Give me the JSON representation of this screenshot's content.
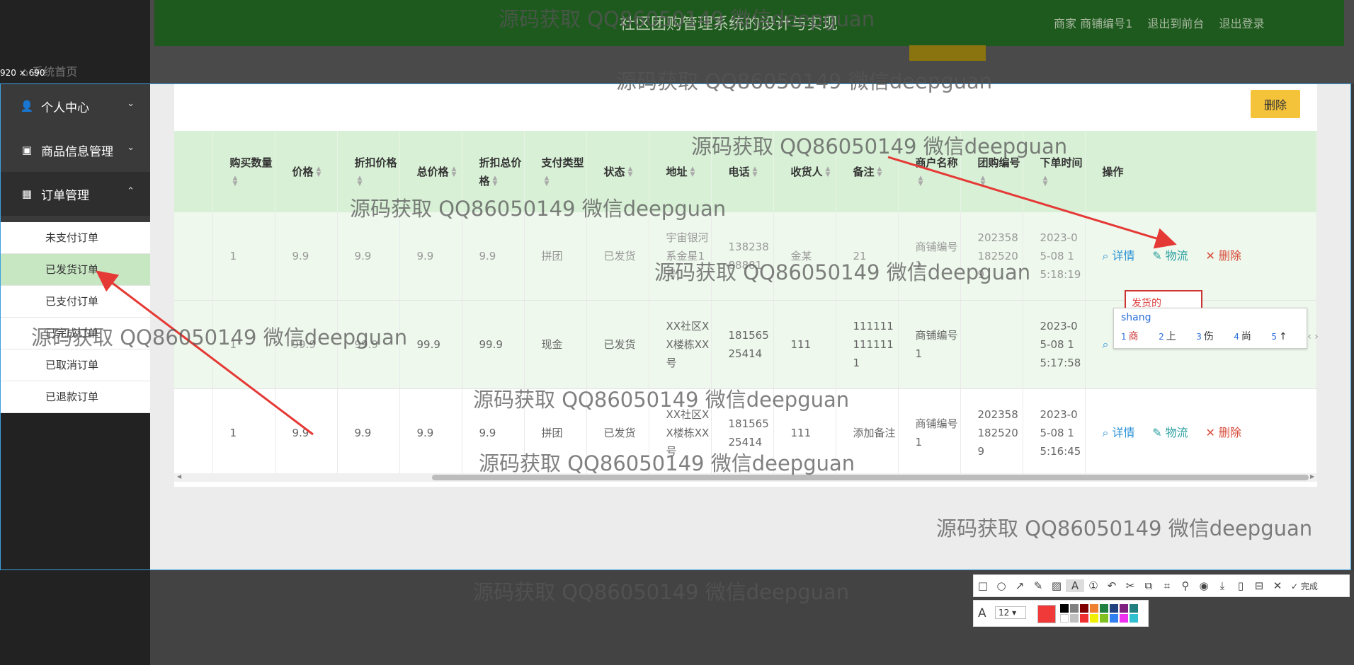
{
  "header": {
    "title": "社区团购管理系统的设计与实现",
    "links": [
      "商家 商铺编号1",
      "退出到前台",
      "退出登录"
    ]
  },
  "home_link": "系统首页",
  "size_label": "920 × 690",
  "sidebar": {
    "menus": [
      {
        "label": "个人中心",
        "icon": "user-icon",
        "chevron": "⌄"
      },
      {
        "label": "商品信息管理",
        "icon": "chat-icon",
        "chevron": "⌄"
      },
      {
        "label": "订单管理",
        "icon": "grid-icon",
        "chevron": "⌃"
      }
    ],
    "submenu": [
      "未支付订单",
      "已发货订单",
      "已支付订单",
      "已完成订单",
      "已取消订单",
      "已退款订单"
    ],
    "active_submenu": "已发货订单"
  },
  "toolbar": {
    "delete_label": "删除"
  },
  "table": {
    "headers": [
      "购买数量",
      "价格",
      "折扣价格",
      "总价格",
      "折扣总价格",
      "支付类型",
      "状态",
      "地址",
      "电话",
      "收货人",
      "备注",
      "商户名称",
      "团购编号",
      "下单时间",
      "操作"
    ],
    "rows": [
      {
        "qty": "1",
        "price": "9.9",
        "discount_price": "9.9",
        "total": "9.9",
        "discount_total": "9.9",
        "pay": "拼团",
        "status": "已发货",
        "address": "宇宙银河系金星1号",
        "phone": "13823888881",
        "receiver": "金某",
        "note": "21",
        "merchant": "商铺编号1",
        "groupno": "2023581825209",
        "time": "2023-05-08 15:18:19"
      },
      {
        "qty": "1",
        "price": "99.9",
        "discount_price": "99.9",
        "total": "99.9",
        "discount_total": "99.9",
        "pay": "现金",
        "status": "已发货",
        "address": "XX社区XX楼栋XX号",
        "phone": "18156525414",
        "receiver": "111",
        "note": "1111111111111",
        "merchant": "商铺编号1",
        "groupno": "",
        "time": "2023-05-08 15:17:58"
      },
      {
        "qty": "1",
        "price": "9.9",
        "discount_price": "9.9",
        "total": "9.9",
        "discount_total": "9.9",
        "pay": "拼团",
        "status": "已发货",
        "address": "XX社区XX楼栋XX号",
        "phone": "18156525414",
        "receiver": "111",
        "note": "添加备注",
        "merchant": "商铺编号1",
        "groupno": "2023581825209",
        "time": "2023-05-08 15:16:45"
      }
    ],
    "actions": {
      "detail": "详情",
      "logistics": "物流",
      "delete": "删除"
    }
  },
  "ime": {
    "input_text": "发货的",
    "pinyin": "shang",
    "candidates": [
      "商",
      "上",
      "伤",
      "尚",
      "↑"
    ],
    "nav": "‹ ›"
  },
  "screenshot_tool": {
    "done_label": "完成",
    "font_size": "12"
  },
  "watermark": "源码获取 QQ86050149 微信deepguan",
  "colors": {
    "header": "#1e5a1e",
    "accent_yellow": "#f5c33a",
    "table_header": "#d8f0d6",
    "active_menu": "#c7e6c2",
    "annotation_red": "#e53935"
  }
}
